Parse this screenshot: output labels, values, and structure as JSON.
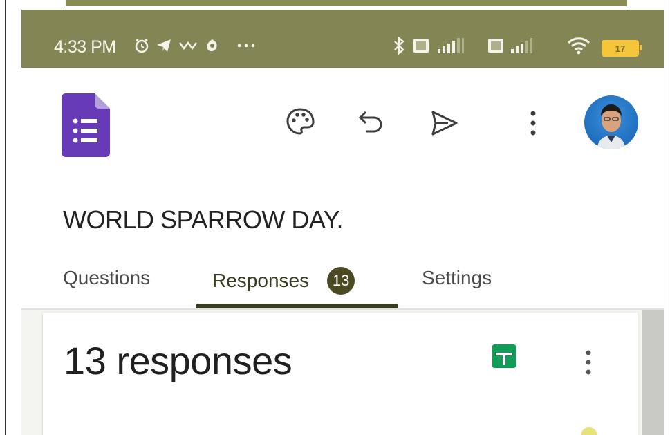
{
  "status_bar": {
    "time": "4:33 PM",
    "battery_level": "17",
    "left_icons": [
      "alarm-icon",
      "telegram-icon",
      "signal-wave-icon",
      "app-icon",
      "more-dots-icon"
    ],
    "right_icons": [
      "bluetooth-icon",
      "sim-icon",
      "cell-signal-icon",
      "sim-icon",
      "cell-signal-icon",
      "wifi-icon",
      "battery-icon"
    ]
  },
  "toolbar": {
    "icons": [
      "google-forms-logo",
      "palette-icon",
      "undo-icon",
      "send-icon",
      "more-vert-icon",
      "avatar"
    ],
    "app_color": "#673ab7"
  },
  "form": {
    "title": "WORLD SPARROW DAY."
  },
  "tabs": [
    {
      "label": "Questions",
      "active": false
    },
    {
      "label": "Responses",
      "active": true,
      "badge": "13"
    },
    {
      "label": "Settings",
      "active": false
    }
  ],
  "responses": {
    "summary": "13 responses",
    "sheets_icon": "google-sheets-icon",
    "more_icon": "more-vert-icon"
  },
  "colors": {
    "status_bar": "#838555",
    "accent": "#3a3c21",
    "badge": "#4b4a22",
    "sheets_green": "#0f9d58"
  }
}
